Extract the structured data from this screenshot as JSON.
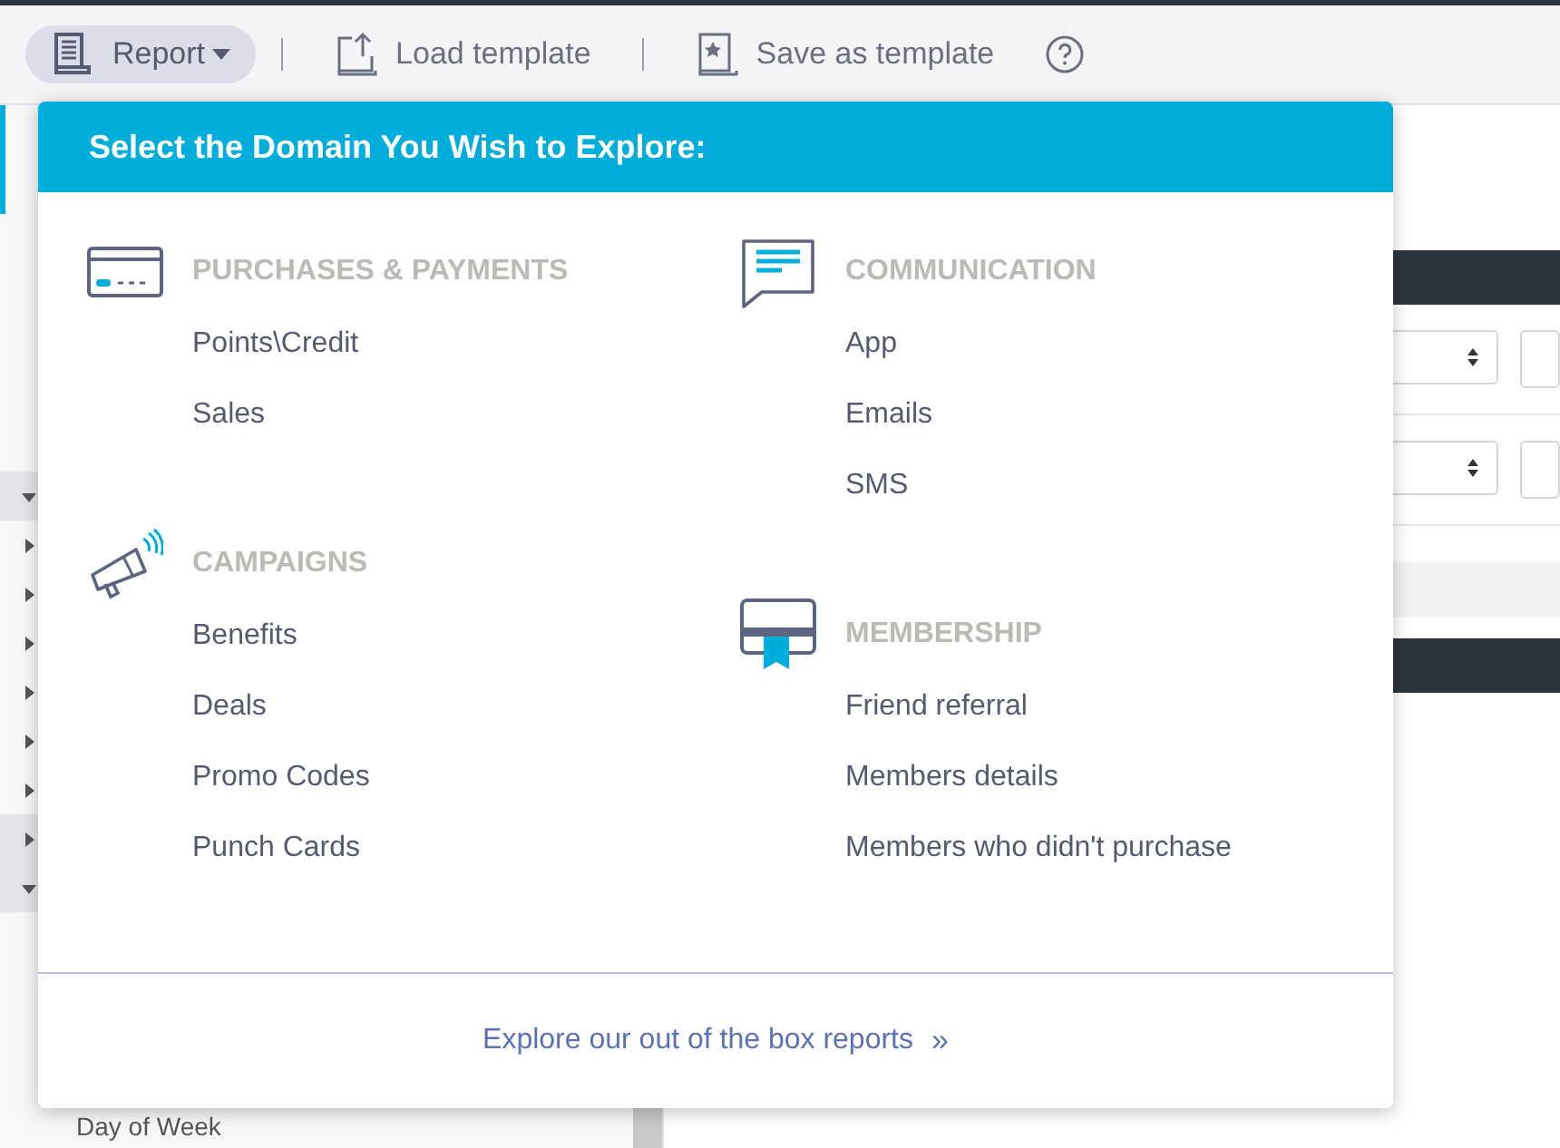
{
  "toolbar": {
    "buttons": [
      {
        "label": "Report",
        "selected": true,
        "dropdown": true
      },
      {
        "label": "Load template",
        "selected": false,
        "dropdown": false
      },
      {
        "label": "Save as template",
        "selected": false,
        "dropdown": false
      }
    ]
  },
  "sidebar": {
    "rows": [
      {
        "kind": "header",
        "expanded": true
      },
      {
        "kind": "item",
        "expanded": false
      },
      {
        "kind": "item",
        "expanded": false
      },
      {
        "kind": "item",
        "expanded": false
      },
      {
        "kind": "item",
        "expanded": false
      },
      {
        "kind": "item",
        "expanded": false
      },
      {
        "kind": "item",
        "expanded": false
      },
      {
        "kind": "header",
        "expanded": false
      },
      {
        "kind": "header",
        "expanded": true
      }
    ],
    "footer_label": "Day of Week"
  },
  "domain_menu": {
    "title": "Select the Domain You Wish to Explore:",
    "columns": [
      [
        {
          "heading": "PURCHASES & PAYMENTS",
          "items": [
            "Points\\Credit",
            "Sales"
          ]
        },
        {
          "heading": "CAMPAIGNS",
          "items": [
            "Benefits",
            "Deals",
            "Promo Codes",
            "Punch Cards"
          ]
        }
      ],
      [
        {
          "heading": "COMMUNICATION",
          "items": [
            "App",
            "Emails",
            "SMS"
          ]
        },
        {
          "heading": "MEMBERSHIP",
          "items": [
            "Friend referral",
            "Members details",
            "Members who didn't purchase"
          ]
        }
      ]
    ],
    "footer_link": "Explore our out of the box reports",
    "footer_link_arrow": "»"
  }
}
